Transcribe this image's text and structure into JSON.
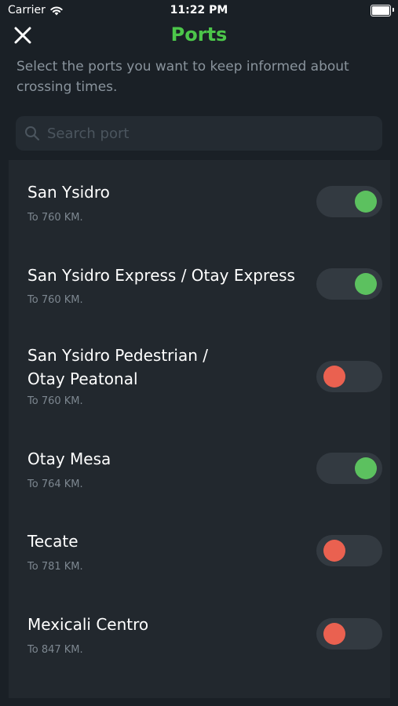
{
  "status_bar": {
    "carrier": "Carrier",
    "time": "11:22 PM"
  },
  "nav": {
    "title": "Ports",
    "close_icon": "close-icon"
  },
  "subtitle": "Select the ports you want to keep informed about crossing times.",
  "search": {
    "placeholder": "Search port",
    "value": ""
  },
  "colors": {
    "background": "#1a2026",
    "card": "#22282e",
    "accent_green": "#4cc64a",
    "toggle_on_knob": "#5cc15f",
    "toggle_off_knob": "#ea6150",
    "toggle_track": "#333a41"
  },
  "ports": [
    {
      "name": "San Ysidro",
      "distance": "To 760 KM.",
      "enabled": true
    },
    {
      "name": "San Ysidro Express / Otay Express",
      "distance": "To 760 KM.",
      "enabled": true
    },
    {
      "name": "San Ysidro Pedestrian / Otay Peatonal",
      "distance": "To 760 KM.",
      "enabled": false
    },
    {
      "name": "Otay Mesa",
      "distance": "To 764 KM.",
      "enabled": true
    },
    {
      "name": "Tecate",
      "distance": "To 781 KM.",
      "enabled": false
    },
    {
      "name": "Mexicali Centro",
      "distance": "To 847 KM.",
      "enabled": false
    }
  ]
}
